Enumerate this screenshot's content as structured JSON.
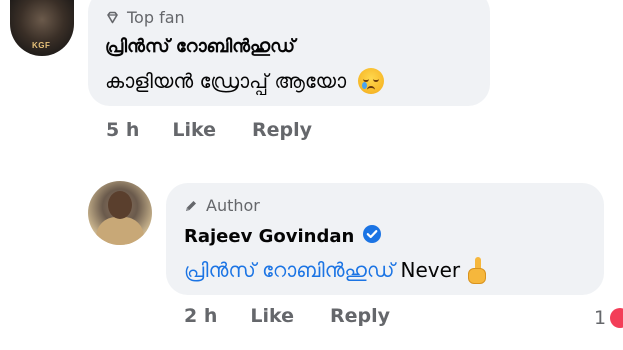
{
  "comment1": {
    "badge": "Top fan",
    "badge_icon": "diamond-icon",
    "author": "പ്രിൻസ് റോബിൻഹുഡ്",
    "text": "കാളിയൻ ഡ്രോപ്പ് ആയോ",
    "emoji": "sad-tear-emoji",
    "avatar_text": "KGF",
    "time": "5 h",
    "like": "Like",
    "reply": "Reply"
  },
  "comment2": {
    "badge": "Author",
    "badge_icon": "pencil-icon",
    "author": "Rajeev Govindan",
    "verified": true,
    "mention": "പ്രിൻസ് റോബിൻഹുഡ്",
    "text": "Never",
    "emoji": "index-finger-up-emoji",
    "time": "2 h",
    "like": "Like",
    "reply": "Reply",
    "reaction_count": "1",
    "reaction_icon": "love-reaction-icon"
  },
  "colors": {
    "bubble": "#f0f2f5",
    "muted": "#65676b",
    "link": "#1b74e4",
    "verified": "#1b74e4"
  }
}
